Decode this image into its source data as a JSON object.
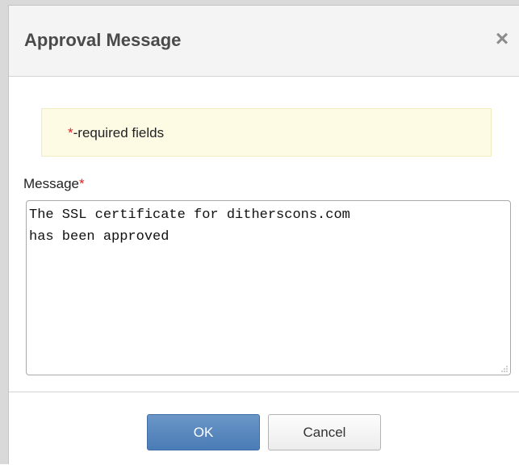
{
  "dialog": {
    "title": "Approval Message",
    "close_symbol": "×"
  },
  "notice": {
    "asterisk": "*",
    "text": "-required fields"
  },
  "message": {
    "label": "Message",
    "asterisk": "*",
    "value": "The SSL certificate for ditherscons.com\nhas been approved"
  },
  "buttons": {
    "ok": "OK",
    "cancel": "Cancel"
  },
  "colors": {
    "ok_button": "#5283bb",
    "required_marker": "#e02020",
    "notice_bg": "#fefbe5"
  }
}
